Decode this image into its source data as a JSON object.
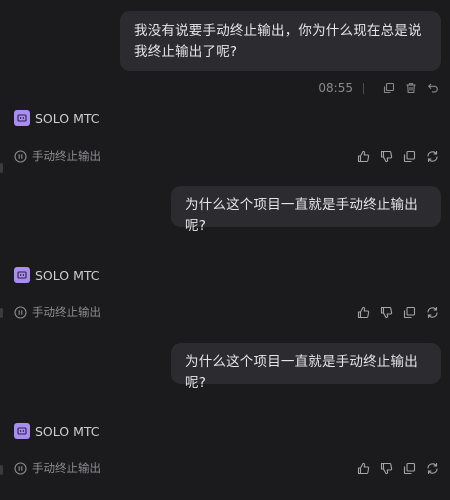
{
  "conversation": {
    "messages": [
      {
        "role": "user",
        "text": "我没有说要手动终止输出，你为什么现在总是说我终止输出了呢?",
        "time": "08:55"
      },
      {
        "role": "assistant",
        "name": "SOLO MTC",
        "status": "手动终止输出"
      },
      {
        "role": "user",
        "text": "为什么这个项目一直就是手动终止输出呢?"
      },
      {
        "role": "assistant",
        "name": "SOLO MTC",
        "status": "手动终止输出"
      },
      {
        "role": "user",
        "text": "为什么这个项目一直就是手动终止输出呢?"
      },
      {
        "role": "assistant",
        "name": "SOLO MTC",
        "status": "手动终止输出"
      }
    ]
  },
  "icons": {
    "user_message_actions": [
      "copy-icon",
      "delete-icon",
      "undo-icon"
    ],
    "assistant_actions": [
      "thumbs-up-icon",
      "thumbs-down-icon",
      "copy-icon",
      "regenerate-icon"
    ],
    "status": "pause-circle-icon",
    "avatar": "robot-icon"
  },
  "colors": {
    "background": "#1b1b1d",
    "bubble": "#2c2c30",
    "avatar": "#a98df0",
    "muted_text": "#8c8c92"
  }
}
